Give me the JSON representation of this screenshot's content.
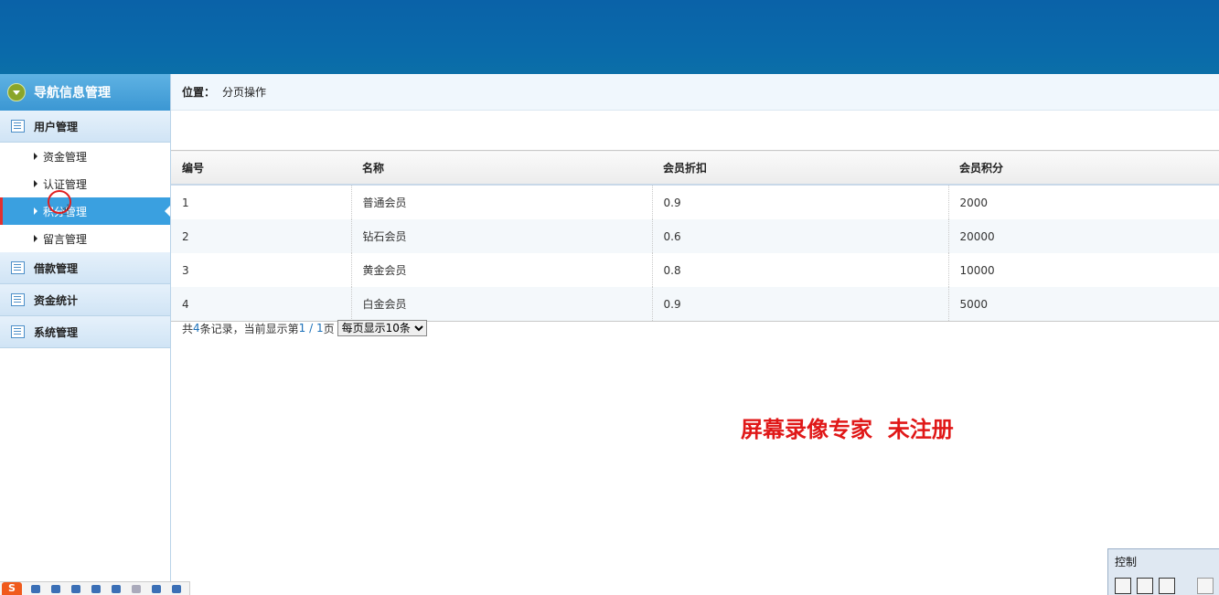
{
  "sidebar": {
    "header": "导航信息管理",
    "groups": [
      {
        "label": "用户管理"
      },
      {
        "label": "借款管理"
      },
      {
        "label": "资金统计"
      },
      {
        "label": "系统管理"
      }
    ],
    "sub_items": [
      "资金管理",
      "认证管理",
      "积分管理",
      "留言管理"
    ],
    "active_sub": "积分管理"
  },
  "place": {
    "label": "位置：",
    "value": "分页操作"
  },
  "table": {
    "headers": [
      "编号",
      "名称",
      "会员折扣",
      "会员积分"
    ],
    "rows": [
      [
        "1",
        "普通会员",
        "0.9",
        "2000"
      ],
      [
        "2",
        "钻石会员",
        "0.6",
        "20000"
      ],
      [
        "3",
        "黄金会员",
        "0.8",
        "10000"
      ],
      [
        "4",
        "白金会员",
        "0.9",
        "5000"
      ]
    ]
  },
  "pager": {
    "prefix": "共",
    "total": "4",
    "middle": "条记录，当前显示第",
    "page": "1 / 1",
    "suffix": "页",
    "per_page_selected": "每页显示10条"
  },
  "watermark": "屏幕录像专家  未注册",
  "control_panel": {
    "title": "控制"
  },
  "taskbar": {
    "ime_logo": "S"
  },
  "colors": {
    "topbar": "#0a6aaa",
    "accent": "#3aa0e0",
    "watermark": "#e01818"
  }
}
